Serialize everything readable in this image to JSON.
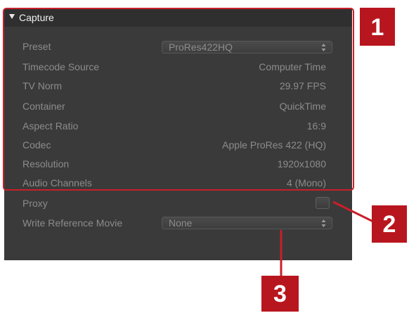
{
  "section": {
    "title": "Capture"
  },
  "rows": [
    {
      "label": "Preset",
      "value": "ProRes422HQ",
      "kind": "select"
    },
    {
      "label": "Timecode Source",
      "value": "Computer Time",
      "kind": "text"
    },
    {
      "label": "TV Norm",
      "value": "29.97 FPS",
      "kind": "text"
    },
    {
      "label": "Container",
      "value": "QuickTime",
      "kind": "text"
    },
    {
      "label": "Aspect Ratio",
      "value": "16:9",
      "kind": "text"
    },
    {
      "label": "Codec",
      "value": "Apple ProRes 422 (HQ)",
      "kind": "text"
    },
    {
      "label": "Resolution",
      "value": "1920x1080",
      "kind": "text"
    },
    {
      "label": "Audio Channels",
      "value": "4 (Mono)",
      "kind": "text"
    },
    {
      "label": "Proxy",
      "value": false,
      "kind": "checkbox"
    },
    {
      "label": "Write Reference Movie",
      "value": "None",
      "kind": "select"
    }
  ],
  "callouts": [
    "1",
    "2",
    "3"
  ],
  "colors": {
    "accent": "#c8202a",
    "badge": "#b8161e",
    "panel": "#3a3a3a",
    "header": "#2f2f2f",
    "label": "#8c8c8c"
  }
}
